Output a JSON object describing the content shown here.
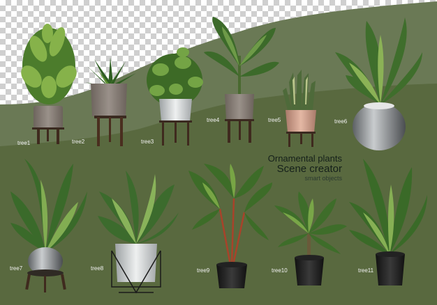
{
  "header": {
    "title_line1": "Ornamental plants",
    "title_line2": "Scene creator",
    "title_line3": "smart objects"
  },
  "labels": [
    "tree1",
    "tree2",
    "tree3",
    "tree4",
    "tree5",
    "tree6",
    "tree7",
    "tree8",
    "tree9",
    "tree10",
    "tree11"
  ],
  "colors": {
    "background_green": "#5b6a48",
    "wave_green": "#6b7a55",
    "leaf_dark": "#3f6a2a",
    "leaf_light": "#7fa64a",
    "text_dark": "#15201a"
  }
}
